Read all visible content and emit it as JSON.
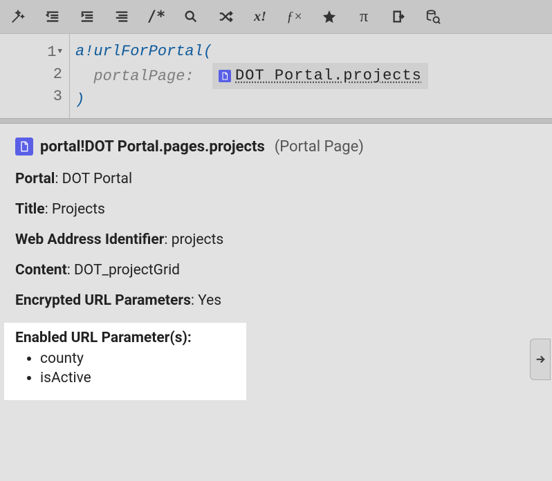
{
  "toolbar": {
    "icons": [
      "magic-wand",
      "outdent",
      "indent",
      "format-lines",
      "comment",
      "search",
      "shuffle",
      "shuffle-clear",
      "fx",
      "star",
      "pi",
      "export",
      "db-play"
    ]
  },
  "editor": {
    "lines": [
      {
        "num": "1",
        "fold": true,
        "fn": "a!urlForPortal",
        "open": "("
      },
      {
        "num": "2",
        "param": "portalPage:",
        "pill": "DOT Portal.projects"
      },
      {
        "num": "3",
        "close": ")"
      }
    ]
  },
  "info": {
    "header_title": "portal!DOT Portal.pages.projects",
    "header_type": "(Portal Page)",
    "rows": {
      "portal": {
        "label": "Portal",
        "value": "DOT Portal"
      },
      "title": {
        "label": "Title",
        "value": "Projects"
      },
      "wai": {
        "label": "Web Address Identifier",
        "value": "projects"
      },
      "content": {
        "label": "Content",
        "value": "DOT_projectGrid"
      },
      "encrypted": {
        "label": "Encrypted URL Parameters",
        "value": "Yes"
      },
      "enabled": {
        "label": "Enabled URL Parameter(s):"
      }
    },
    "params": [
      "county",
      "isActive"
    ]
  }
}
